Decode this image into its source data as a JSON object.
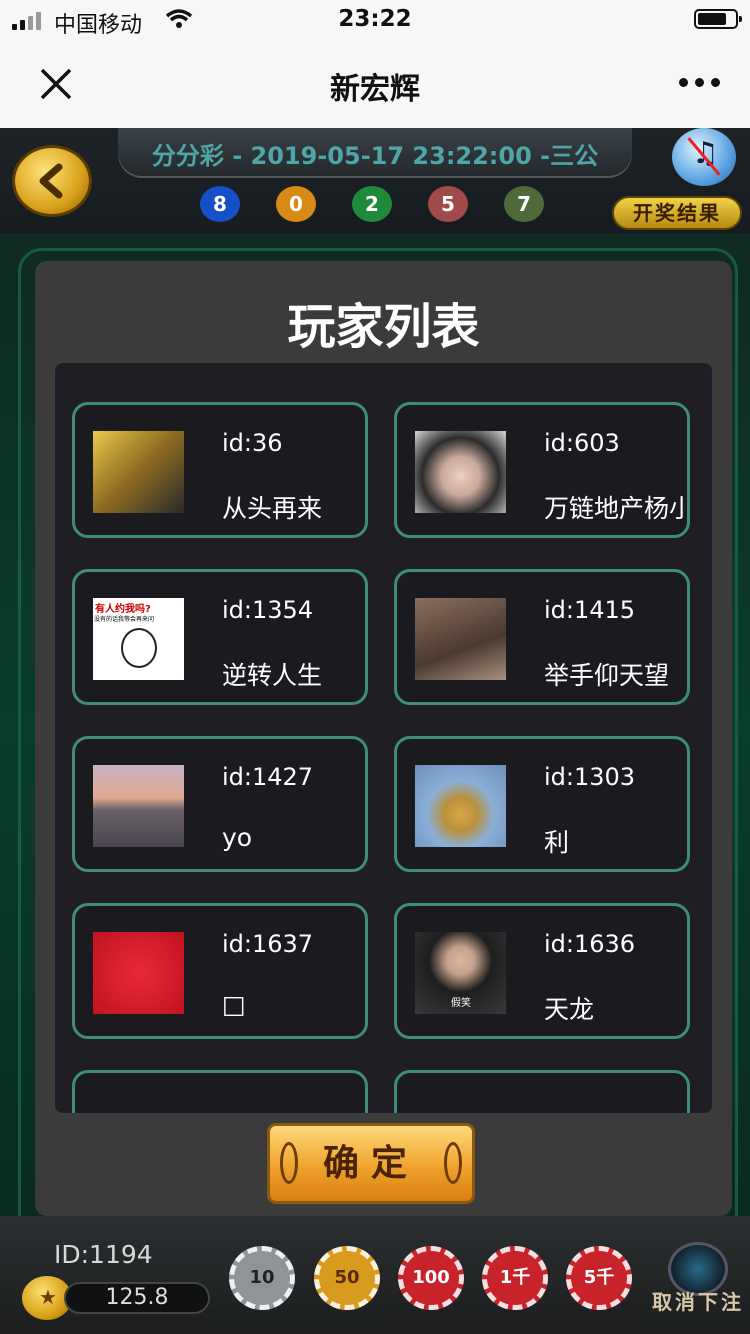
{
  "status_bar": {
    "carrier": "中国移动",
    "time": "23:22"
  },
  "nav": {
    "title": "新宏辉"
  },
  "game": {
    "lottery_title": "分分彩 - 2019-05-17 23:22:00 -三公",
    "balls": [
      {
        "value": "8",
        "color": "#1550c8"
      },
      {
        "value": "0",
        "color": "#d88a16"
      },
      {
        "value": "2",
        "color": "#1f8a3a"
      },
      {
        "value": "5",
        "color": "#a14a4c"
      },
      {
        "value": "7",
        "color": "#4e6a38"
      }
    ],
    "results_label": "开奖结果"
  },
  "modal": {
    "title": "玩家列表",
    "players": [
      {
        "id": "id:36",
        "name": "从头再来",
        "avatar_color": "#caa43a"
      },
      {
        "id": "id:603",
        "name": "万链地产杨小",
        "avatar_color": "#c9b8b0"
      },
      {
        "id": "id:1354",
        "name": "逆转人生",
        "avatar_color": "#ffffff",
        "avatar_caption_1": "有人约我吗?",
        "avatar_caption_2": "没有的话我等会再来问"
      },
      {
        "id": "id:1415",
        "name": "举手仰天望",
        "avatar_color": "#6a5446"
      },
      {
        "id": "id:1427",
        "name": "yo",
        "avatar_color": "#8a7a80"
      },
      {
        "id": "id:1303",
        "name": "利",
        "avatar_color": "#c8a050"
      },
      {
        "id": "id:1637",
        "name": "□",
        "avatar_color": "#e01e2e"
      },
      {
        "id": "id:1636",
        "name": "天龙",
        "avatar_color": "#3a3a3a",
        "avatar_caption_1": "假笑"
      }
    ],
    "confirm_label": "确定"
  },
  "bottom": {
    "user_id": "ID:1194",
    "balance": "125.8",
    "chips": [
      {
        "label": "10",
        "color": "#8f9499",
        "text_color": "#222"
      },
      {
        "label": "50",
        "color": "#d99b1e",
        "text_color": "#5a2b00"
      },
      {
        "label": "100",
        "color": "#c8232b",
        "text_color": "#fff"
      },
      {
        "label": "1千",
        "color": "#c8232b",
        "text_color": "#fff"
      },
      {
        "label": "5千",
        "color": "#c8232b",
        "text_color": "#fff"
      }
    ],
    "cancel_label": "取消下注"
  }
}
